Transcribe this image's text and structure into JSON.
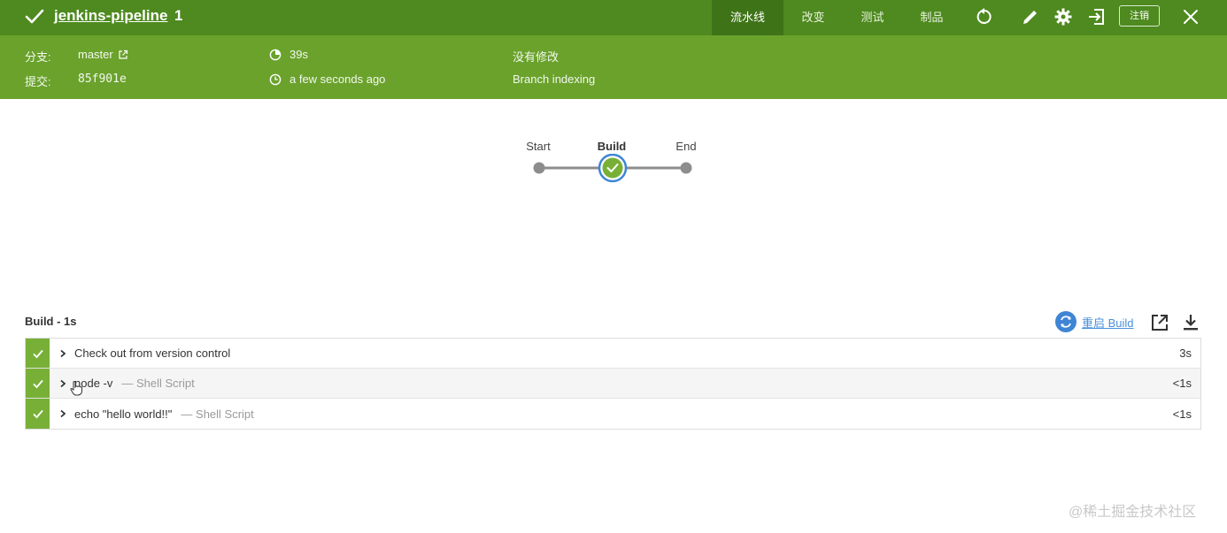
{
  "header": {
    "job_name": "jenkins-pipeline",
    "run_number": "1",
    "tabs": [
      {
        "label": "流水线",
        "active": true
      },
      {
        "label": "改变",
        "active": false
      },
      {
        "label": "测试",
        "active": false
      },
      {
        "label": "制品",
        "active": false
      }
    ],
    "logout_label": "注销",
    "icons": [
      "success-check-icon",
      "rerun-icon",
      "edit-icon",
      "settings-icon",
      "exit-icon",
      "close-icon"
    ]
  },
  "info": {
    "branch_label": "分支:",
    "branch_value": "master",
    "commit_label": "提交:",
    "commit_value": "85f901e",
    "duration": "39s",
    "time_ago": "a few seconds ago",
    "changes": "没有修改",
    "cause": "Branch indexing"
  },
  "pipeline": {
    "stages": [
      "Start",
      "Build",
      "End"
    ],
    "selected": "Build"
  },
  "section": {
    "title": "Build - 1s",
    "restart_label": "重启 Build"
  },
  "steps": [
    {
      "name": "Check out from version control",
      "sub": "",
      "duration": "3s"
    },
    {
      "name": "node -v",
      "sub": "— Shell Script",
      "duration": "<1s"
    },
    {
      "name": "echo \"hello world!!\"",
      "sub": "— Shell Script",
      "duration": "<1s"
    }
  ],
  "colors": {
    "topbar": "#4e8a1f",
    "infobar": "#6aa22c",
    "success": "#78b037",
    "link": "#4a90d9"
  },
  "watermark": "@稀土掘金技术社区"
}
